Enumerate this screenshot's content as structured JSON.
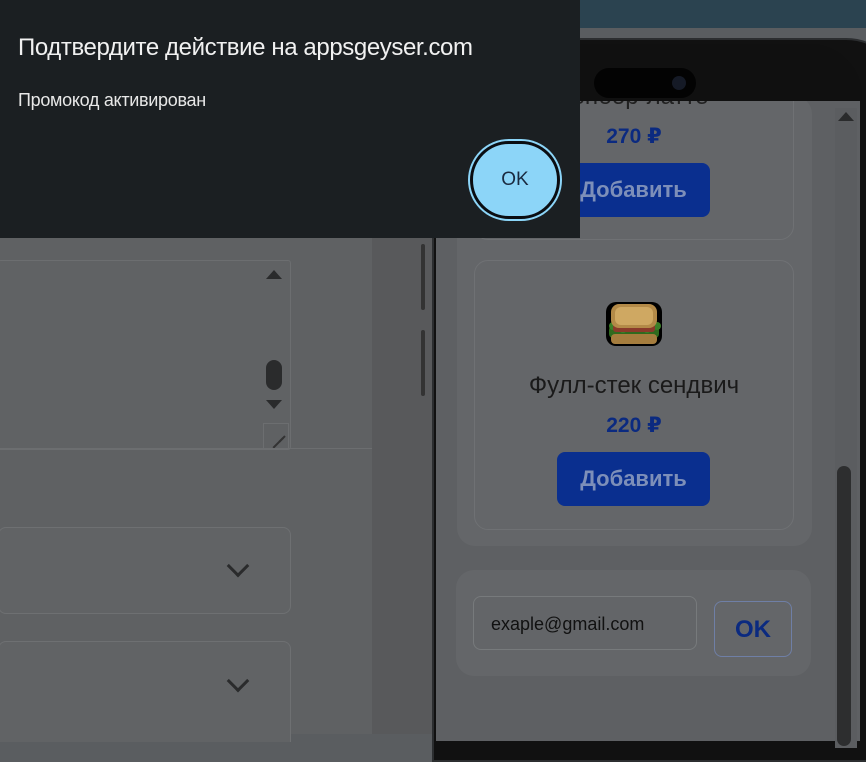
{
  "dialog": {
    "title": "Подтвердите действие на appsgeyser.com",
    "message": "Промокод активирован",
    "ok_label": "OK"
  },
  "products": [
    {
      "name": "сенбор-латте",
      "price": "270 ₽",
      "add_label": "Добавить"
    },
    {
      "name": "Фулл-стек сендвич",
      "price": "220 ₽",
      "add_label": "Добавить",
      "icon": "sandwich-icon"
    }
  ],
  "promo": {
    "email_value": "exaple@gmail.com",
    "ok_label": "OK"
  },
  "colors": {
    "dialog_bg": "#1b1f22",
    "dialog_button": "#8cd5f8",
    "accent_blue": "#0a2f8f"
  }
}
